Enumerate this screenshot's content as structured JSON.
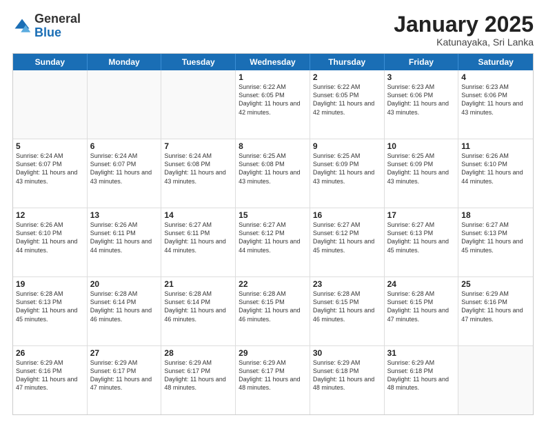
{
  "header": {
    "logo_general": "General",
    "logo_blue": "Blue",
    "title": "January 2025",
    "location": "Katunayaka, Sri Lanka"
  },
  "weekdays": [
    "Sunday",
    "Monday",
    "Tuesday",
    "Wednesday",
    "Thursday",
    "Friday",
    "Saturday"
  ],
  "rows": [
    [
      {
        "day": "",
        "sunrise": "",
        "sunset": "",
        "daylight": ""
      },
      {
        "day": "",
        "sunrise": "",
        "sunset": "",
        "daylight": ""
      },
      {
        "day": "",
        "sunrise": "",
        "sunset": "",
        "daylight": ""
      },
      {
        "day": "1",
        "sunrise": "Sunrise: 6:22 AM",
        "sunset": "Sunset: 6:05 PM",
        "daylight": "Daylight: 11 hours and 42 minutes."
      },
      {
        "day": "2",
        "sunrise": "Sunrise: 6:22 AM",
        "sunset": "Sunset: 6:05 PM",
        "daylight": "Daylight: 11 hours and 42 minutes."
      },
      {
        "day": "3",
        "sunrise": "Sunrise: 6:23 AM",
        "sunset": "Sunset: 6:06 PM",
        "daylight": "Daylight: 11 hours and 43 minutes."
      },
      {
        "day": "4",
        "sunrise": "Sunrise: 6:23 AM",
        "sunset": "Sunset: 6:06 PM",
        "daylight": "Daylight: 11 hours and 43 minutes."
      }
    ],
    [
      {
        "day": "5",
        "sunrise": "Sunrise: 6:24 AM",
        "sunset": "Sunset: 6:07 PM",
        "daylight": "Daylight: 11 hours and 43 minutes."
      },
      {
        "day": "6",
        "sunrise": "Sunrise: 6:24 AM",
        "sunset": "Sunset: 6:07 PM",
        "daylight": "Daylight: 11 hours and 43 minutes."
      },
      {
        "day": "7",
        "sunrise": "Sunrise: 6:24 AM",
        "sunset": "Sunset: 6:08 PM",
        "daylight": "Daylight: 11 hours and 43 minutes."
      },
      {
        "day": "8",
        "sunrise": "Sunrise: 6:25 AM",
        "sunset": "Sunset: 6:08 PM",
        "daylight": "Daylight: 11 hours and 43 minutes."
      },
      {
        "day": "9",
        "sunrise": "Sunrise: 6:25 AM",
        "sunset": "Sunset: 6:09 PM",
        "daylight": "Daylight: 11 hours and 43 minutes."
      },
      {
        "day": "10",
        "sunrise": "Sunrise: 6:25 AM",
        "sunset": "Sunset: 6:09 PM",
        "daylight": "Daylight: 11 hours and 43 minutes."
      },
      {
        "day": "11",
        "sunrise": "Sunrise: 6:26 AM",
        "sunset": "Sunset: 6:10 PM",
        "daylight": "Daylight: 11 hours and 44 minutes."
      }
    ],
    [
      {
        "day": "12",
        "sunrise": "Sunrise: 6:26 AM",
        "sunset": "Sunset: 6:10 PM",
        "daylight": "Daylight: 11 hours and 44 minutes."
      },
      {
        "day": "13",
        "sunrise": "Sunrise: 6:26 AM",
        "sunset": "Sunset: 6:11 PM",
        "daylight": "Daylight: 11 hours and 44 minutes."
      },
      {
        "day": "14",
        "sunrise": "Sunrise: 6:27 AM",
        "sunset": "Sunset: 6:11 PM",
        "daylight": "Daylight: 11 hours and 44 minutes."
      },
      {
        "day": "15",
        "sunrise": "Sunrise: 6:27 AM",
        "sunset": "Sunset: 6:12 PM",
        "daylight": "Daylight: 11 hours and 44 minutes."
      },
      {
        "day": "16",
        "sunrise": "Sunrise: 6:27 AM",
        "sunset": "Sunset: 6:12 PM",
        "daylight": "Daylight: 11 hours and 45 minutes."
      },
      {
        "day": "17",
        "sunrise": "Sunrise: 6:27 AM",
        "sunset": "Sunset: 6:13 PM",
        "daylight": "Daylight: 11 hours and 45 minutes."
      },
      {
        "day": "18",
        "sunrise": "Sunrise: 6:27 AM",
        "sunset": "Sunset: 6:13 PM",
        "daylight": "Daylight: 11 hours and 45 minutes."
      }
    ],
    [
      {
        "day": "19",
        "sunrise": "Sunrise: 6:28 AM",
        "sunset": "Sunset: 6:13 PM",
        "daylight": "Daylight: 11 hours and 45 minutes."
      },
      {
        "day": "20",
        "sunrise": "Sunrise: 6:28 AM",
        "sunset": "Sunset: 6:14 PM",
        "daylight": "Daylight: 11 hours and 46 minutes."
      },
      {
        "day": "21",
        "sunrise": "Sunrise: 6:28 AM",
        "sunset": "Sunset: 6:14 PM",
        "daylight": "Daylight: 11 hours and 46 minutes."
      },
      {
        "day": "22",
        "sunrise": "Sunrise: 6:28 AM",
        "sunset": "Sunset: 6:15 PM",
        "daylight": "Daylight: 11 hours and 46 minutes."
      },
      {
        "day": "23",
        "sunrise": "Sunrise: 6:28 AM",
        "sunset": "Sunset: 6:15 PM",
        "daylight": "Daylight: 11 hours and 46 minutes."
      },
      {
        "day": "24",
        "sunrise": "Sunrise: 6:28 AM",
        "sunset": "Sunset: 6:15 PM",
        "daylight": "Daylight: 11 hours and 47 minutes."
      },
      {
        "day": "25",
        "sunrise": "Sunrise: 6:29 AM",
        "sunset": "Sunset: 6:16 PM",
        "daylight": "Daylight: 11 hours and 47 minutes."
      }
    ],
    [
      {
        "day": "26",
        "sunrise": "Sunrise: 6:29 AM",
        "sunset": "Sunset: 6:16 PM",
        "daylight": "Daylight: 11 hours and 47 minutes."
      },
      {
        "day": "27",
        "sunrise": "Sunrise: 6:29 AM",
        "sunset": "Sunset: 6:17 PM",
        "daylight": "Daylight: 11 hours and 47 minutes."
      },
      {
        "day": "28",
        "sunrise": "Sunrise: 6:29 AM",
        "sunset": "Sunset: 6:17 PM",
        "daylight": "Daylight: 11 hours and 48 minutes."
      },
      {
        "day": "29",
        "sunrise": "Sunrise: 6:29 AM",
        "sunset": "Sunset: 6:17 PM",
        "daylight": "Daylight: 11 hours and 48 minutes."
      },
      {
        "day": "30",
        "sunrise": "Sunrise: 6:29 AM",
        "sunset": "Sunset: 6:18 PM",
        "daylight": "Daylight: 11 hours and 48 minutes."
      },
      {
        "day": "31",
        "sunrise": "Sunrise: 6:29 AM",
        "sunset": "Sunset: 6:18 PM",
        "daylight": "Daylight: 11 hours and 48 minutes."
      },
      {
        "day": "",
        "sunrise": "",
        "sunset": "",
        "daylight": ""
      }
    ]
  ]
}
